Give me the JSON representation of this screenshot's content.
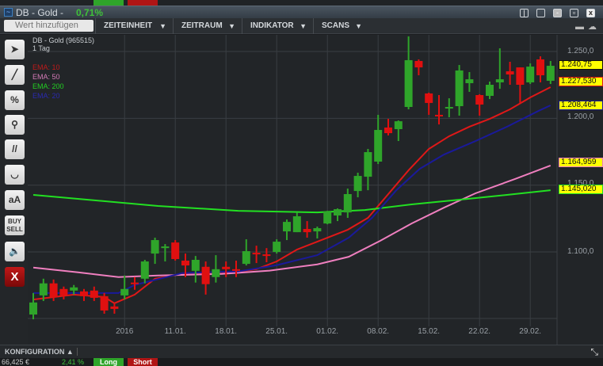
{
  "window": {
    "title": "DB - Gold -",
    "change": "0,71%"
  },
  "window_buttons": [
    "pin-icon",
    "restore-icon",
    "minimize-icon",
    "tile-icon",
    "close-icon"
  ],
  "toolbar": {
    "search_placeholder": "Wert hinzufügen",
    "menus": [
      "ZEITEINHEIT",
      "ZEITRAUM",
      "INDIKATOR",
      "SCANS"
    ]
  },
  "chart_header": {
    "instrument": "DB - Gold (965515)",
    "interval": "1 Tag"
  },
  "tools": [
    "select-add",
    "line",
    "percent",
    "zoom",
    "parallel",
    "curve",
    "aA",
    "BUY SELL",
    "sound",
    "X"
  ],
  "colors": {
    "up": "#2fa52a",
    "down": "#e01010",
    "ema10": "#e01818",
    "ema50": "#ef7fbf",
    "ema200": "#22e022",
    "ema20": "#1a1a9a",
    "tag": "#ffff00"
  },
  "bottom": {
    "config_label": "KONFIGURATION ▲"
  },
  "bottom_strip": {
    "value": "66,425 €",
    "change": "2,41 %",
    "long": "Long",
    "short": "Short"
  },
  "chart_data": {
    "type": "candlestick",
    "title": "DB - Gold (965515)",
    "ylim": [
      1040,
      1265
    ],
    "yticks": [
      {
        "v": 1250,
        "label": "1.250,0"
      },
      {
        "v": 1200,
        "label": "1.200,0"
      },
      {
        "v": 1150,
        "label": "1.150,0"
      },
      {
        "v": 1100,
        "label": "1.100,0"
      }
    ],
    "xticks": [
      {
        "i": 9,
        "label": "2016"
      },
      {
        "i": 14,
        "label": "11.01."
      },
      {
        "i": 19,
        "label": "18.01."
      },
      {
        "i": 24,
        "label": "25.01."
      },
      {
        "i": 29,
        "label": "01.02."
      },
      {
        "i": 34,
        "label": "08.02."
      },
      {
        "i": 39,
        "label": "15.02."
      },
      {
        "i": 44,
        "label": "22.02."
      },
      {
        "i": 49,
        "label": "29.02."
      }
    ],
    "ohlc": [
      [
        1053.2,
        1069.3,
        1049.6,
        1062.2
      ],
      [
        1067.5,
        1080,
        1063.3,
        1076.5
      ],
      [
        1076.5,
        1079.4,
        1063.3,
        1066.3
      ],
      [
        1072.3,
        1074.1,
        1064.5,
        1067.5
      ],
      [
        1071.1,
        1075.3,
        1068.1,
        1073.5
      ],
      [
        1070.5,
        1072.3,
        1063.3,
        1066.9
      ],
      [
        1071.1,
        1074.1,
        1063.3,
        1065.7
      ],
      [
        1066.9,
        1069.3,
        1053.8,
        1056.2
      ],
      [
        1059.2,
        1061.6,
        1053.8,
        1057.4
      ],
      [
        1067.5,
        1082.4,
        1064.5,
        1072.3
      ],
      [
        1077.1,
        1081.2,
        1071.7,
        1075.9
      ],
      [
        1080,
        1094.1,
        1076.5,
        1092.9
      ],
      [
        1098.8,
        1110.7,
        1091.1,
        1108.9
      ],
      [
        1102.9,
        1105.9,
        1092.9,
        1104.1
      ],
      [
        1107.1,
        1108.9,
        1093.5,
        1094.7
      ],
      [
        1093.5,
        1098.8,
        1081.2,
        1089.9
      ],
      [
        1085.9,
        1097,
        1077.1,
        1094.1
      ],
      [
        1088.9,
        1092.9,
        1068.1,
        1075.9
      ],
      [
        1081.2,
        1097.6,
        1077.1,
        1087.1
      ],
      [
        1088.9,
        1092.9,
        1081.2,
        1087.1
      ],
      [
        1087.1,
        1093.5,
        1081.2,
        1085.9
      ],
      [
        1091.1,
        1109.5,
        1089.9,
        1100.6
      ],
      [
        1099.4,
        1104.7,
        1091.7,
        1098.2
      ],
      [
        1098.2,
        1102.9,
        1092.3,
        1097
      ],
      [
        1100,
        1109.5,
        1098.8,
        1107.7
      ],
      [
        1115.4,
        1124.3,
        1108.9,
        1122.5
      ],
      [
        1114.8,
        1129.6,
        1114.8,
        1126.7
      ],
      [
        1117.2,
        1123.1,
        1110.7,
        1114.8
      ],
      [
        1115.4,
        1119,
        1110.1,
        1117.8
      ],
      [
        1121.3,
        1130.8,
        1120.7,
        1130.2
      ],
      [
        1127.3,
        1132.6,
        1123.1,
        1132
      ],
      [
        1129.6,
        1147.4,
        1125.5,
        1143.3
      ],
      [
        1145.6,
        1159.3,
        1140.9,
        1156.9
      ],
      [
        1156.3,
        1177.1,
        1146.2,
        1174.7
      ],
      [
        1167.6,
        1202.6,
        1165.8,
        1191.3
      ],
      [
        1193.1,
        1199.6,
        1187.2,
        1188.9
      ],
      [
        1191.9,
        1198.4,
        1183,
        1197.8
      ],
      [
        1208.5,
        1261.3,
        1206.7,
        1243.5
      ],
      [
        1242.9,
        1244.1,
        1232.2,
        1238.1
      ],
      [
        1218.6,
        1219.2,
        1202.6,
        1211.5
      ],
      [
        1202.6,
        1217.4,
        1195.4,
        1201.4
      ],
      [
        1207.3,
        1215,
        1200.8,
        1208.5
      ],
      [
        1209.1,
        1239.9,
        1202,
        1235.8
      ],
      [
        1226.3,
        1234.6,
        1219.8,
        1229.2
      ],
      [
        1217.4,
        1218,
        1202,
        1210.3
      ],
      [
        1216.8,
        1227.5,
        1214.4,
        1225.1
      ],
      [
        1226.9,
        1252.4,
        1222.1,
        1229.2
      ],
      [
        1235.2,
        1242.3,
        1225.1,
        1232.8
      ],
      [
        1238.1,
        1238.1,
        1211.5,
        1225.1
      ],
      [
        1226.9,
        1241.1,
        1225.7,
        1238.7
      ],
      [
        1244.1,
        1246.4,
        1226.9,
        1232.2
      ],
      [
        1228.1,
        1242.9,
        1225.7,
        1239.3
      ]
    ],
    "series": [
      {
        "name": "EMA: 10",
        "color": "#e01818",
        "last": "1.227,530",
        "points": [
          [
            0,
            1064.4
          ],
          [
            4,
            1068.1
          ],
          [
            7,
            1066.3
          ],
          [
            8,
            1061.6
          ],
          [
            10,
            1068.1
          ],
          [
            12,
            1080
          ],
          [
            15,
            1084
          ],
          [
            19,
            1084
          ],
          [
            22,
            1087.1
          ],
          [
            24,
            1092.9
          ],
          [
            26,
            1101.8
          ],
          [
            28,
            1107.7
          ],
          [
            31,
            1116.6
          ],
          [
            33,
            1125.5
          ],
          [
            35,
            1143.3
          ],
          [
            37,
            1161.1
          ],
          [
            39,
            1177.1
          ],
          [
            41,
            1186.6
          ],
          [
            43,
            1193.7
          ],
          [
            45,
            1199.6
          ],
          [
            47,
            1206.7
          ],
          [
            49,
            1215.6
          ],
          [
            51,
            1223.3
          ]
        ]
      },
      {
        "name": "EMA: 50",
        "color": "#ef7fbf",
        "last": "1.164,959",
        "points": [
          [
            0,
            1088.3
          ],
          [
            4.5,
            1084.7
          ],
          [
            8.4,
            1081.2
          ],
          [
            12.3,
            1082.4
          ],
          [
            18.6,
            1083.6
          ],
          [
            23.3,
            1086
          ],
          [
            28,
            1090.7
          ],
          [
            31.1,
            1096.4
          ],
          [
            34.2,
            1108.3
          ],
          [
            37.3,
            1121.3
          ],
          [
            40.5,
            1133.2
          ],
          [
            43.6,
            1143.9
          ],
          [
            47.5,
            1154.6
          ],
          [
            51,
            1164.7
          ]
        ]
      },
      {
        "name": "EMA: 200",
        "color": "#22e022",
        "last": "1.145,020",
        "points": [
          [
            0,
            1142.7
          ],
          [
            4.5,
            1139.7
          ],
          [
            12.3,
            1134.4
          ],
          [
            20.2,
            1130.8
          ],
          [
            28,
            1129.6
          ],
          [
            32.7,
            1131.4
          ],
          [
            37.3,
            1135.6
          ],
          [
            42,
            1139.1
          ],
          [
            46.7,
            1142.7
          ],
          [
            51,
            1146.2
          ]
        ]
      },
      {
        "name": "EMA: 20",
        "color": "#1a1a9a",
        "last": "1.208,464",
        "points": [
          [
            0,
            1069.3
          ],
          [
            8.4,
            1069.3
          ],
          [
            10,
            1075.3
          ],
          [
            14.7,
            1084.2
          ],
          [
            20.2,
            1085.4
          ],
          [
            24,
            1090.1
          ],
          [
            28,
            1097.6
          ],
          [
            31.1,
            1110.7
          ],
          [
            33.4,
            1125.5
          ],
          [
            35.8,
            1146.2
          ],
          [
            38.1,
            1162.2
          ],
          [
            40.5,
            1172.9
          ],
          [
            43.6,
            1183
          ],
          [
            46.7,
            1193.7
          ],
          [
            49.8,
            1205.5
          ],
          [
            51,
            1209.7
          ]
        ]
      }
    ],
    "last_price": "1.240,75"
  }
}
